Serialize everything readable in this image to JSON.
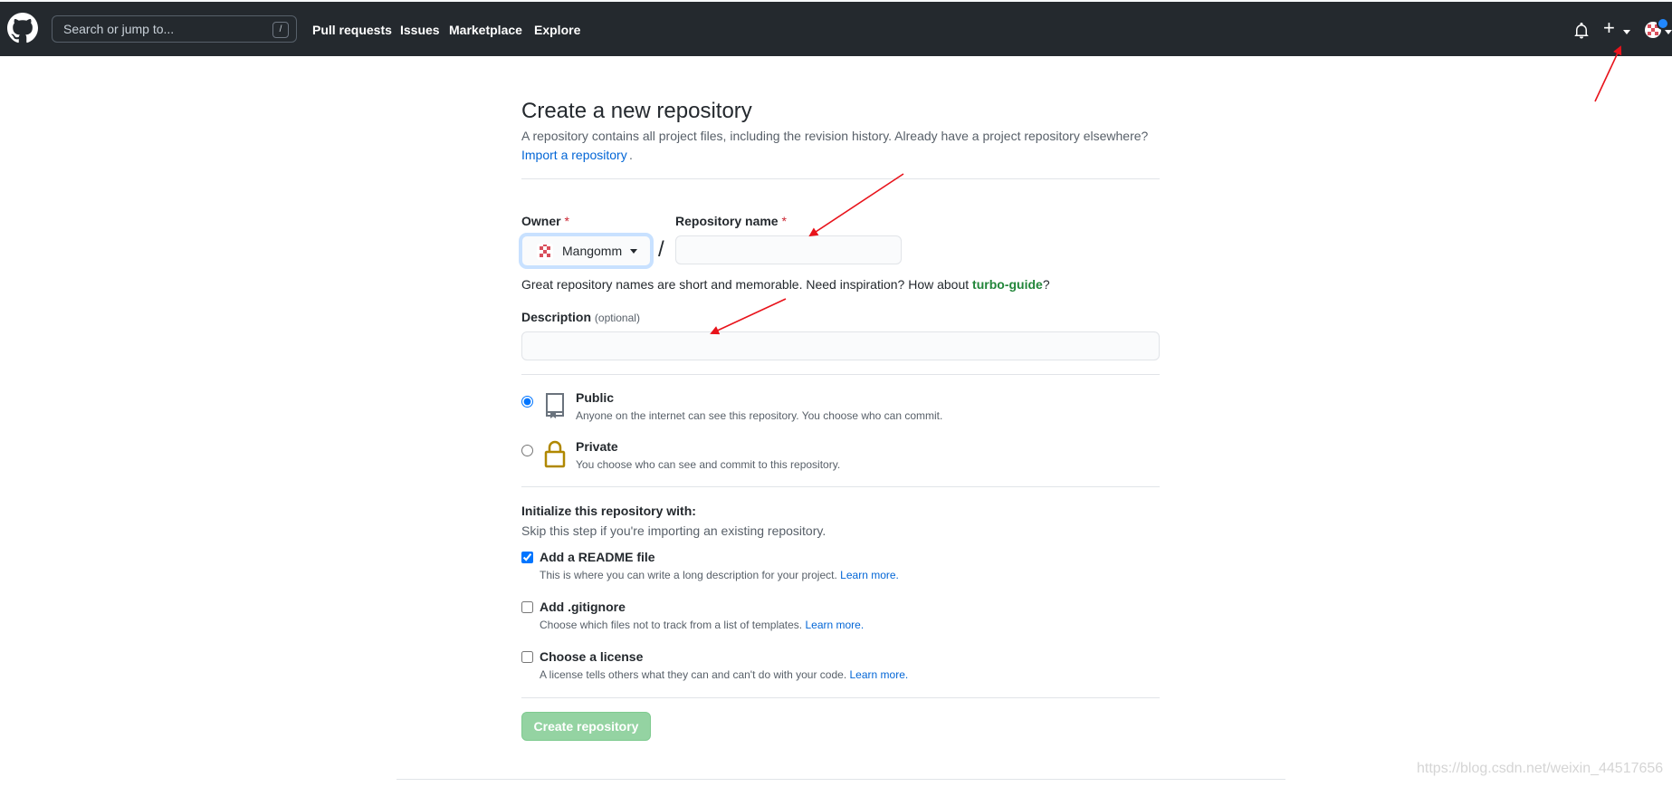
{
  "header": {
    "search_placeholder": "Search or jump to...",
    "search_shortcut": "/",
    "nav": [
      "Pull requests",
      "Issues",
      "Marketplace",
      "Explore"
    ],
    "plus_symbol": "+"
  },
  "page": {
    "title": "Create a new repository",
    "subtitle": "A repository contains all project files, including the revision history. Already have a project repository elsewhere?",
    "import_link": "Import a repository",
    "import_suffix": "."
  },
  "owner": {
    "label": "Owner",
    "required_mark": "*",
    "value": "Mangomm"
  },
  "separator": "/",
  "repo_name": {
    "label": "Repository name",
    "required_mark": "*",
    "value": ""
  },
  "name_hint": {
    "text": "Great repository names are short and memorable. Need inspiration? How about ",
    "suggestion": "turbo-guide",
    "suffix": "?"
  },
  "description": {
    "label": "Description",
    "optional": "(optional)",
    "value": ""
  },
  "visibility": [
    {
      "title": "Public",
      "desc": "Anyone on the internet can see this repository. You choose who can commit.",
      "selected": true
    },
    {
      "title": "Private",
      "desc": "You choose who can see and commit to this repository.",
      "selected": false
    }
  ],
  "init": {
    "heading": "Initialize this repository with:",
    "subheading": "Skip this step if you're importing an existing repository.",
    "options": [
      {
        "title": "Add a README file",
        "desc": "This is where you can write a long description for your project.",
        "link": "Learn more.",
        "checked": true
      },
      {
        "title": "Add .gitignore",
        "desc": "Choose which files not to track from a list of templates.",
        "link": "Learn more.",
        "checked": false
      },
      {
        "title": "Choose a license",
        "desc": "A license tells others what they can and can't do with your code.",
        "link": "Learn more.",
        "checked": false
      }
    ]
  },
  "submit_label": "Create repository",
  "watermark": "https://blog.csdn.net/weixin_44517656",
  "colors": {
    "header_bg": "#24292e",
    "link": "#0366d6",
    "annotation": "#e8131b",
    "button_disabled": "#94d3a2"
  }
}
